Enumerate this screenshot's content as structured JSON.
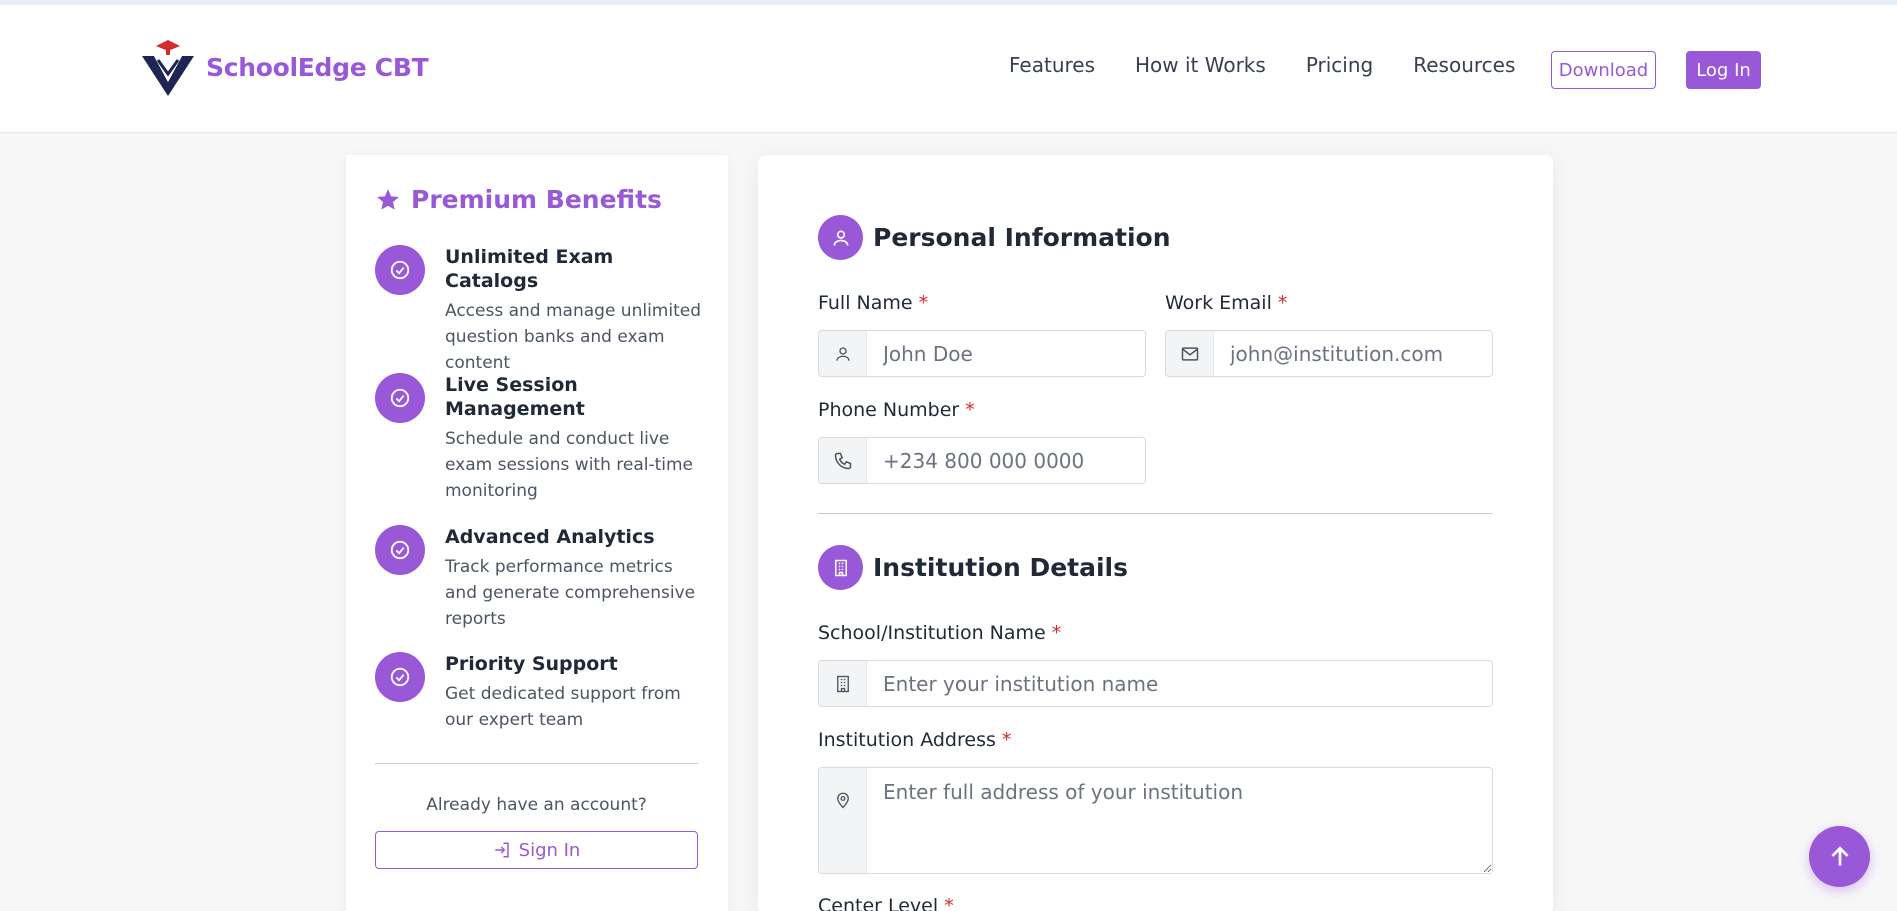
{
  "brand": {
    "name": "SchoolEdge CBT",
    "accent": "#9858d8"
  },
  "nav": {
    "links": [
      "Features",
      "How it Works",
      "Pricing",
      "Resources"
    ],
    "download_label": "Download",
    "login_label": "Log In"
  },
  "sidebar": {
    "title": "Premium Benefits",
    "benefits": [
      {
        "title": "Unlimited Exam Catalogs",
        "desc": "Access and manage unlimited question banks and exam content"
      },
      {
        "title": "Live Session Management",
        "desc": "Schedule and conduct live exam sessions with real-time monitoring"
      },
      {
        "title": "Advanced Analytics",
        "desc": "Track performance metrics and generate comprehensive reports"
      },
      {
        "title": "Priority Support",
        "desc": "Get dedicated support from our expert team"
      }
    ],
    "account_prompt": "Already have an account?",
    "signin_label": "Sign In"
  },
  "form": {
    "personal": {
      "title": "Personal Information",
      "full_name": {
        "label": "Full Name",
        "placeholder": "John Doe"
      },
      "work_email": {
        "label": "Work Email",
        "placeholder": "john@institution.com"
      },
      "phone": {
        "label": "Phone Number",
        "placeholder": "+234 800 000 0000"
      }
    },
    "institution": {
      "title": "Institution Details",
      "name": {
        "label": "School/Institution Name",
        "placeholder": "Enter your institution name"
      },
      "address": {
        "label": "Institution Address",
        "placeholder": "Enter full address of your institution"
      },
      "center_level": {
        "label": "Center Level"
      }
    },
    "required_mark": "*"
  }
}
